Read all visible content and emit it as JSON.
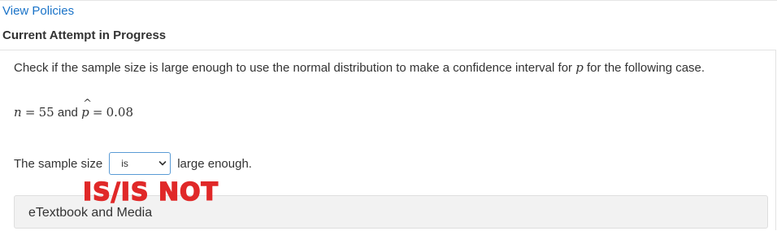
{
  "header": {
    "policies_link": "View Policies",
    "attempt_heading": "Current Attempt in Progress"
  },
  "question": {
    "text_before": "Check if the sample size is large enough to use the normal distribution to make a confidence interval for ",
    "var_p": "p",
    "text_after": " for the following case.",
    "formula": {
      "n_symbol": "n",
      "equals": "=",
      "n_value": "55",
      "and": "and",
      "phat_symbol": "p",
      "hat": "^",
      "phat_value": "0.08"
    }
  },
  "answer": {
    "prefix": "The sample size",
    "select_value": "is",
    "suffix": "large enough."
  },
  "overlay": {
    "watermark": "IS/IS NOT"
  },
  "resources": {
    "etextbook_label": "eTextbook and Media"
  },
  "colors": {
    "link": "#1a73c8",
    "select_border": "#5a9bd5",
    "watermark": "#e02828"
  }
}
